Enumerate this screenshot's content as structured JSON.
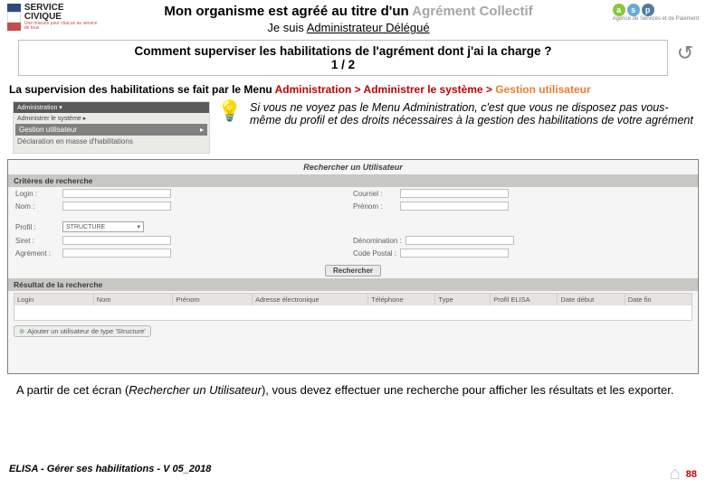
{
  "header": {
    "logo_left_l1": "SERVICE",
    "logo_left_l2": "CIVIQUE",
    "logo_left_sub": "Une mission pour chacun au service de tous",
    "title_prefix": "Mon organisme est agréé au titre d'un ",
    "title_grey": "Agrément Collectif",
    "subtitle_prefix": "Je suis ",
    "subtitle_role": "Administrateur Délégué",
    "asp_label": "Agence de Services et de Paiement"
  },
  "question": {
    "line1": "Comment superviser les habilitations de l'agrément dont j'ai la charge ?",
    "line2": "1 / 2"
  },
  "intro": {
    "prefix": "La supervision des habilitations se fait par le Menu ",
    "menu1": "Administration",
    "sep1": " > ",
    "menu2": "Administrer le système",
    "sep2": " > ",
    "menu3": "Gestion utilisateur"
  },
  "menu_shot": {
    "topbar": "Administration ▾",
    "grp": "Administrer le système ▸",
    "sel": "Gestion utilisateur",
    "cursor": "▸",
    "other": "Déclaration en masse d'habilitations"
  },
  "tip": "Si vous ne voyez pas le Menu Administration, c'est que vous ne disposez pas vous-même du profil et des droits nécessaires à la gestion des habilitations de votre agrément",
  "frame": {
    "title": "Rechercher un Utilisateur",
    "bar_criteria": "Critères de recherche",
    "labels": {
      "login": "Login :",
      "nom": "Nom :",
      "courriel": "Courriel :",
      "prenom": "Prénom :",
      "profil": "Profil :",
      "siret": "Siret :",
      "agrement": "Agrément :",
      "denom": "Dénomination :",
      "cp": "Code Postal :"
    },
    "profil_value": "STRUCTURE",
    "btn_search": "Rechercher",
    "bar_result": "Résultat de la recherche",
    "cols": {
      "login": "Login",
      "nom": "Nom",
      "prenom": "Prénom",
      "email": "Adresse électronique",
      "tel": "Téléphone",
      "type": "Type",
      "profil": "Profil ELISA",
      "ddeb": "Date début",
      "dfin": "Date fin"
    },
    "btn_add": "Ajouter un utilisateur de type 'Structure'"
  },
  "bottom": {
    "p1a": "A partir de cet écran (",
    "p1b": "Rechercher un Utilisateur",
    "p1c": "), vous devez effectuer une recherche pour afficher les résultats et les exporter."
  },
  "footer": {
    "left": "ELISA - Gérer ses habilitations - V 05_2018",
    "page": "88"
  }
}
